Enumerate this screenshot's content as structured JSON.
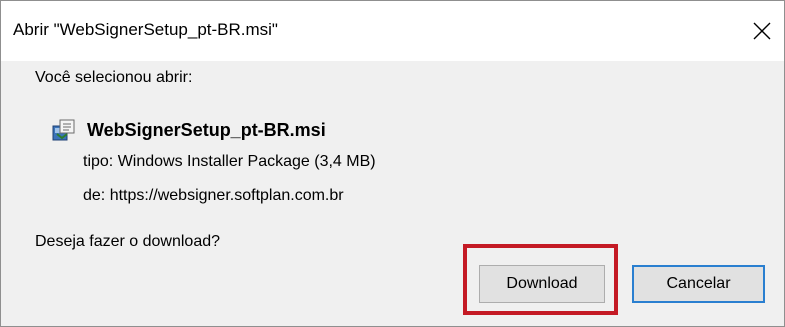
{
  "dialog": {
    "title": "Abrir \"WebSignerSetup_pt-BR.msi\"",
    "intro": "Você selecionou abrir:",
    "file_name": "WebSignerSetup_pt-BR.msi",
    "type_label": "tipo:",
    "type_value": "Windows Installer Package (3,4 MB)",
    "from_label": "de:",
    "from_value": "https://websigner.softplan.com.br",
    "question": "Deseja fazer o download?",
    "download_label": "Download",
    "cancel_label": "Cancelar"
  },
  "colors": {
    "highlight": "#c41a24",
    "focus_border": "#2a7fd0",
    "dialog_bg": "#f0f0f0"
  },
  "icons": {
    "close": "close-icon",
    "file": "msi-installer-icon"
  }
}
